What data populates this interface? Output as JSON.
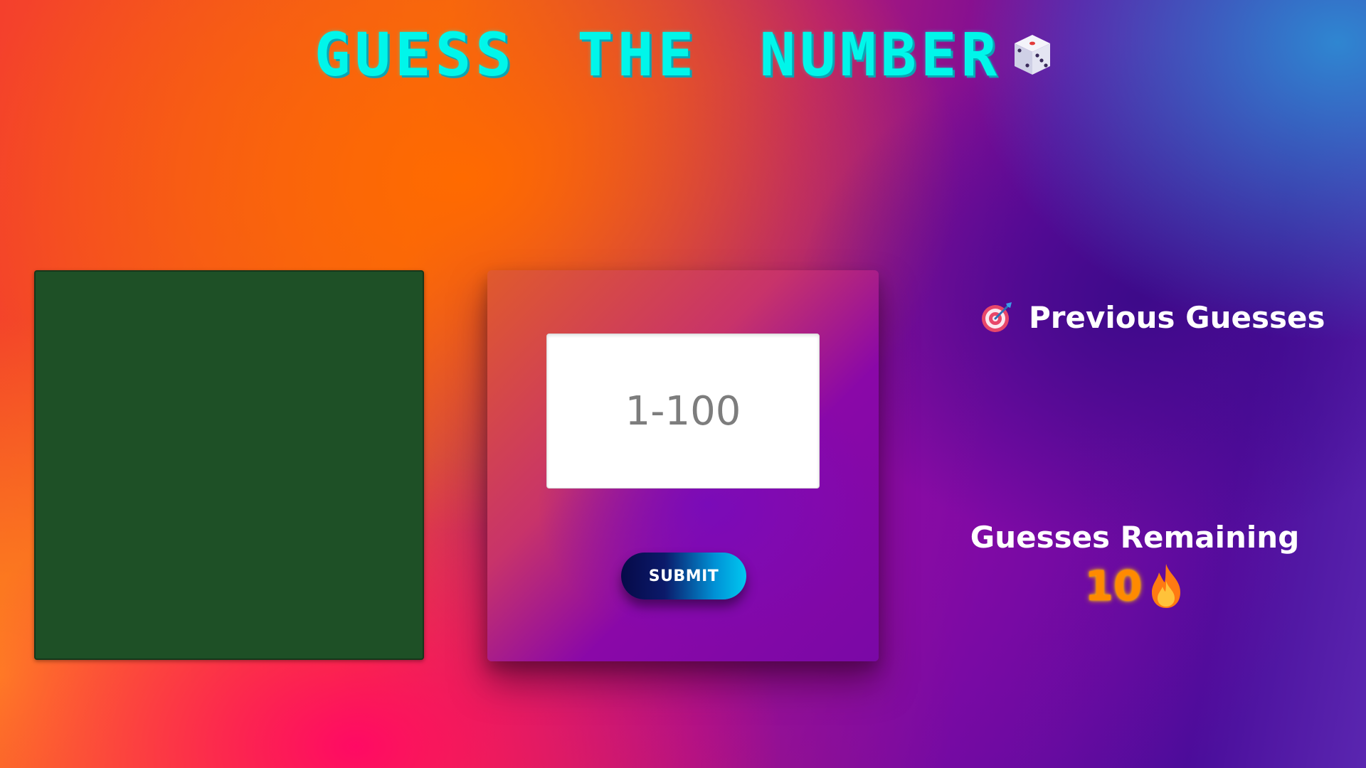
{
  "header": {
    "title": "GUESS THE NUMBER",
    "icon": "dice-icon"
  },
  "game": {
    "input_placeholder": "1-100",
    "input_value": "",
    "submit_label": "SUBMIT"
  },
  "previous_guesses": {
    "icon": "target-icon",
    "label": "Previous Guesses",
    "items": []
  },
  "remaining": {
    "label": "Guesses Remaining",
    "count": "10",
    "icon": "fire-icon"
  },
  "colors": {
    "title": "#00f6ea",
    "left_panel": "#1e5026",
    "input_bg": "#ffffff",
    "remaining_count": "#ff8a00"
  }
}
